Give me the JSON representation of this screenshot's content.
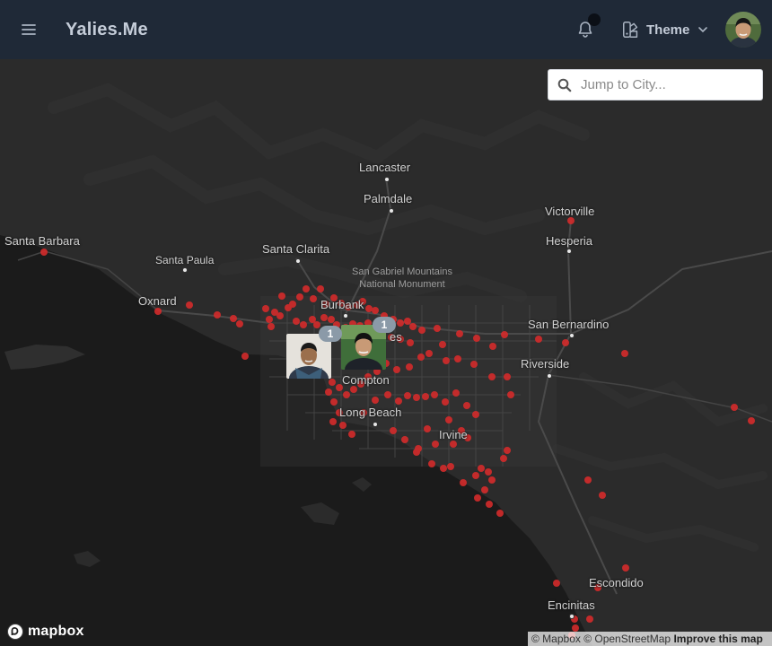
{
  "app": {
    "title": "Yalies.Me"
  },
  "header": {
    "theme_label": "Theme",
    "menu_icon": "hamburger-menu-icon",
    "bell_icon": "bell-icon",
    "theme_icon": "swatch-book-icon"
  },
  "search": {
    "placeholder": "Jump to City...",
    "value": ""
  },
  "map": {
    "cities": {
      "lancaster": "Lancaster",
      "palmdale": "Palmdale",
      "victorville": "Victorville",
      "hesperia": "Hesperia",
      "santa_barbara": "Santa Barbara",
      "santa_paula": "Santa Paula",
      "santa_clarita": "Santa Clarita",
      "oxnard": "Oxnard",
      "burbank": "Burbank",
      "los_angeles_partial": "es",
      "san_bernardino": "San Bernardino",
      "riverside": "Riverside",
      "compton": "Compton",
      "long_beach": "Long Beach",
      "irvine": "Irvine",
      "escondido": "Escondido",
      "encinitas": "Encinitas"
    },
    "poi": {
      "line1": "San Gabriel Mountains",
      "line2": "National Monument"
    },
    "clusters": [
      {
        "count": "1"
      },
      {
        "count": "1"
      }
    ],
    "marker_color": "#d42b2b",
    "land_color": "#2a2a2a",
    "water_color": "#1a1a1a"
  },
  "footer": {
    "logo_text": "mapbox",
    "attribution": "© Mapbox © OpenStreetMap",
    "improve": "Improve this map"
  },
  "colors": {
    "navbar": "#1f2937",
    "nav_text": "#c4ccd8",
    "badge": "#8b9aa8"
  }
}
